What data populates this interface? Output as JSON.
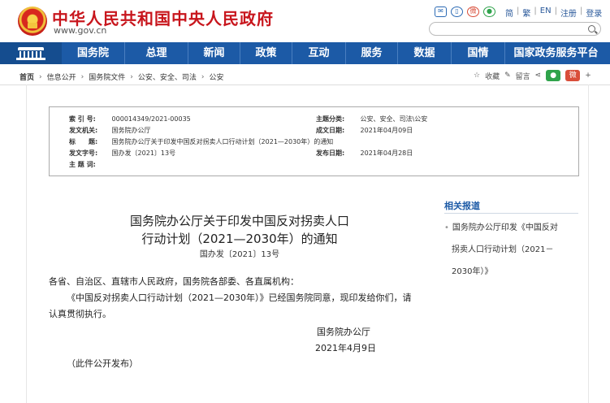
{
  "header": {
    "site_title": "中华人民共和国中央人民政府",
    "site_url": "www.gov.cn",
    "icons": [
      "mail-icon",
      "mobile-icon",
      "weibo-icon",
      "wechat-icon"
    ],
    "languages": [
      "简",
      "繁",
      "EN",
      "注册",
      "登录"
    ]
  },
  "nav": {
    "items": [
      "国务院",
      "总理",
      "新闻",
      "政策",
      "互动",
      "服务",
      "数据",
      "国情",
      "国家政务服务平台"
    ]
  },
  "breadcrumb": [
    "首页",
    "信息公开",
    "国务院文件",
    "公安、安全、司法",
    "公安"
  ],
  "actions": {
    "favorite": "收藏",
    "comment": "留言"
  },
  "info": {
    "index_no_label": "索 引 号:",
    "index_no": "000014349/2021-00035",
    "issuer_label": "发文机关:",
    "issuer": "国务院办公厅",
    "subject_label": "标　　题:",
    "subject": "国务院办公厅关于印发中国反对拐卖人口行动计划（2021—2030年）的通知",
    "doc_no_label": "发文字号:",
    "doc_no": "国办发〔2021〕13号",
    "keywords_label": "主 题 词:",
    "category_label": "主题分类:",
    "category": "公安、安全、司法\\公安",
    "created_label": "成文日期:",
    "created": "2021年04月09日",
    "published_label": "发布日期:",
    "published": "2021年04月28日"
  },
  "article": {
    "title_line1": "国务院办公厅关于印发中国反对拐卖人口",
    "title_line2": "行动计划（2021—2030年）的通知",
    "doc_number": "国办发〔2021〕13号",
    "salutation": "各省、自治区、直辖市人民政府，国务院各部委、各直属机构：",
    "body_line1": "《中国反对拐卖人口行动计划（2021—2030年）》已经国务院同意，现印发给你们，请",
    "body_line2": "认真贯彻执行。",
    "signature": "国务院办公厅",
    "date": "2021年4月9日",
    "note": "（此件公开发布）"
  },
  "sidebar": {
    "heading": "相关报道",
    "link_line1": "国务院办公厅印发《中国反对",
    "link_line2": "拐卖人口行动计划（2021－",
    "link_line3": "2030年）》"
  },
  "colors": {
    "brand_red": "#c8161d",
    "nav_blue": "#1c5aa6"
  }
}
